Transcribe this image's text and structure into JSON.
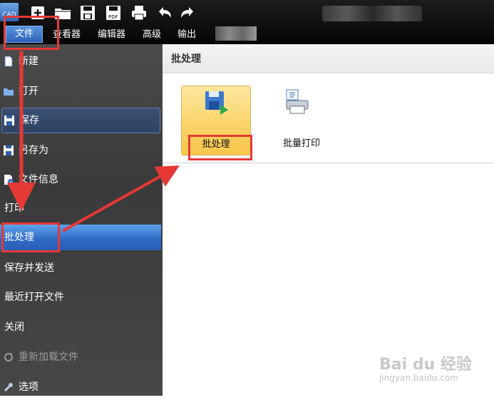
{
  "app": {
    "logo_text": "CAD"
  },
  "menu": {
    "tabs": [
      {
        "label": "文件"
      },
      {
        "label": "查看器"
      },
      {
        "label": "编辑器"
      },
      {
        "label": "高级"
      },
      {
        "label": "输出"
      }
    ]
  },
  "quick_access": [
    "add-icon",
    "open-folder-icon",
    "save-icon",
    "save-pdf-icon",
    "print-icon",
    "undo-icon",
    "redo-icon"
  ],
  "sidebar": {
    "items": [
      {
        "label": "新建",
        "icon": "new-document-icon"
      },
      {
        "label": "打开",
        "icon": "open-folder-icon"
      },
      {
        "label": "保存",
        "icon": "save-icon"
      },
      {
        "label": "另存为",
        "icon": "save-as-icon"
      },
      {
        "label": "文件信息",
        "icon": "file-info-icon"
      },
      {
        "label": "打印"
      },
      {
        "label": "批处理"
      },
      {
        "label": "保存并发送"
      },
      {
        "label": "最近打开文件"
      },
      {
        "label": "关闭"
      },
      {
        "label": "重新加载文件",
        "icon": "reload-icon"
      },
      {
        "label": "选项",
        "icon": "options-icon"
      }
    ]
  },
  "panel": {
    "title": "批处理",
    "buttons": [
      {
        "label": "批处理",
        "icon": "batch-process-icon"
      },
      {
        "label": "批量打印",
        "icon": "batch-print-icon"
      }
    ]
  },
  "watermark": {
    "title": "Bai du 经验",
    "subtitle": "jingyan.baidu.com"
  },
  "colors": {
    "toolbar_bg": "#0d0d0d",
    "sidebar_bg": "#3f3f3f",
    "selected_blue": "#2d68c4",
    "annotation_red": "#e53935",
    "highlight_yellow": "#fbd46a"
  }
}
